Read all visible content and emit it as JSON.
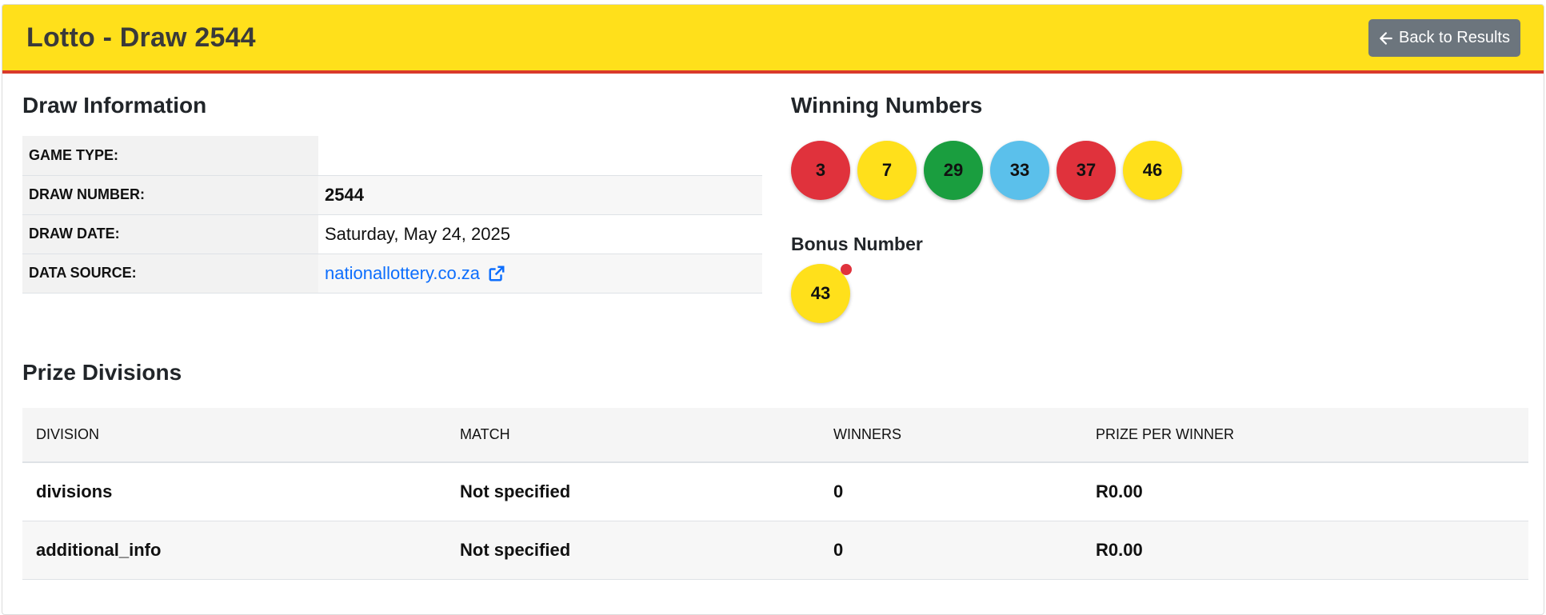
{
  "header": {
    "title": "Lotto - Draw 2544",
    "back_label": "Back to Results",
    "bg_color": "#ffe01b",
    "border_color": "#d93a2b"
  },
  "draw_info": {
    "title": "Draw Information",
    "rows": [
      {
        "label": "GAME TYPE:",
        "value": ""
      },
      {
        "label": "DRAW NUMBER:",
        "value": "2544"
      },
      {
        "label": "DRAW DATE:",
        "value": "Saturday, May 24, 2025"
      },
      {
        "label": "DATA SOURCE:",
        "value": "nationallottery.co.za"
      }
    ]
  },
  "winning": {
    "title": "Winning Numbers",
    "balls": [
      {
        "number": "3",
        "color": "#e0323c"
      },
      {
        "number": "7",
        "color": "#ffe01b"
      },
      {
        "number": "29",
        "color": "#1a9e3f"
      },
      {
        "number": "33",
        "color": "#5bc0eb"
      },
      {
        "number": "37",
        "color": "#e0323c"
      },
      {
        "number": "46",
        "color": "#ffe01b"
      }
    ],
    "bonus_label": "Bonus Number",
    "bonus": {
      "number": "43",
      "color": "#ffe01b"
    }
  },
  "prizes": {
    "title": "Prize Divisions",
    "columns": [
      "DIVISION",
      "MATCH",
      "WINNERS",
      "PRIZE PER WINNER"
    ],
    "rows": [
      {
        "division": "divisions",
        "match": "Not specified",
        "winners": "0",
        "prize": "R0.00"
      },
      {
        "division": "additional_info",
        "match": "Not specified",
        "winners": "0",
        "prize": "R0.00"
      }
    ]
  }
}
